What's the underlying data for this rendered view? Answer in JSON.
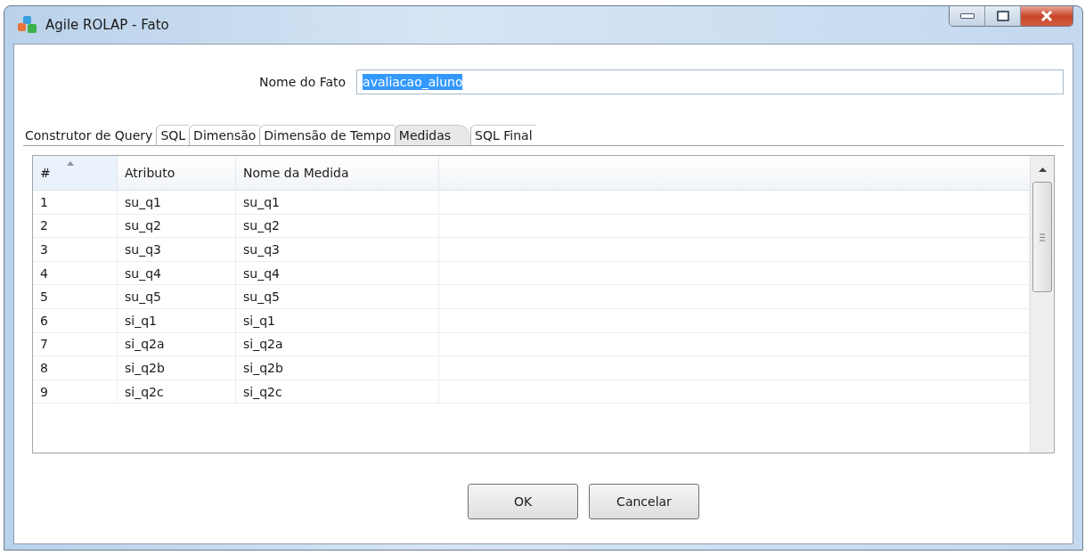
{
  "window": {
    "title": "Agile ROLAP - Fato"
  },
  "fact_name": {
    "label": "Nome do Fato",
    "value": "avaliacao_aluno",
    "text_selected": true
  },
  "tabs": [
    {
      "label": "Construtor de Query",
      "selected": false
    },
    {
      "label": "SQL",
      "selected": false
    },
    {
      "label": "Dimensão",
      "selected": false
    },
    {
      "label": "Dimensão de Tempo",
      "selected": false
    },
    {
      "label": "Medidas",
      "selected": true
    },
    {
      "label": "SQL Final",
      "selected": false
    }
  ],
  "table": {
    "columns": [
      "#",
      "Atributo",
      "Nome da Medida"
    ],
    "rows": [
      [
        "1",
        "su_q1",
        "su_q1"
      ],
      [
        "2",
        "su_q2",
        "su_q2"
      ],
      [
        "3",
        "su_q3",
        "su_q3"
      ],
      [
        "4",
        "su_q4",
        "su_q4"
      ],
      [
        "5",
        "su_q5",
        "su_q5"
      ],
      [
        "6",
        "si_q1",
        "si_q1"
      ],
      [
        "7",
        "si_q2a",
        "si_q2a"
      ],
      [
        "8",
        "si_q2b",
        "si_q2b"
      ],
      [
        "9",
        "si_q2c",
        "si_q2c"
      ]
    ]
  },
  "buttons": [
    "OK",
    "Cancelar"
  ]
}
